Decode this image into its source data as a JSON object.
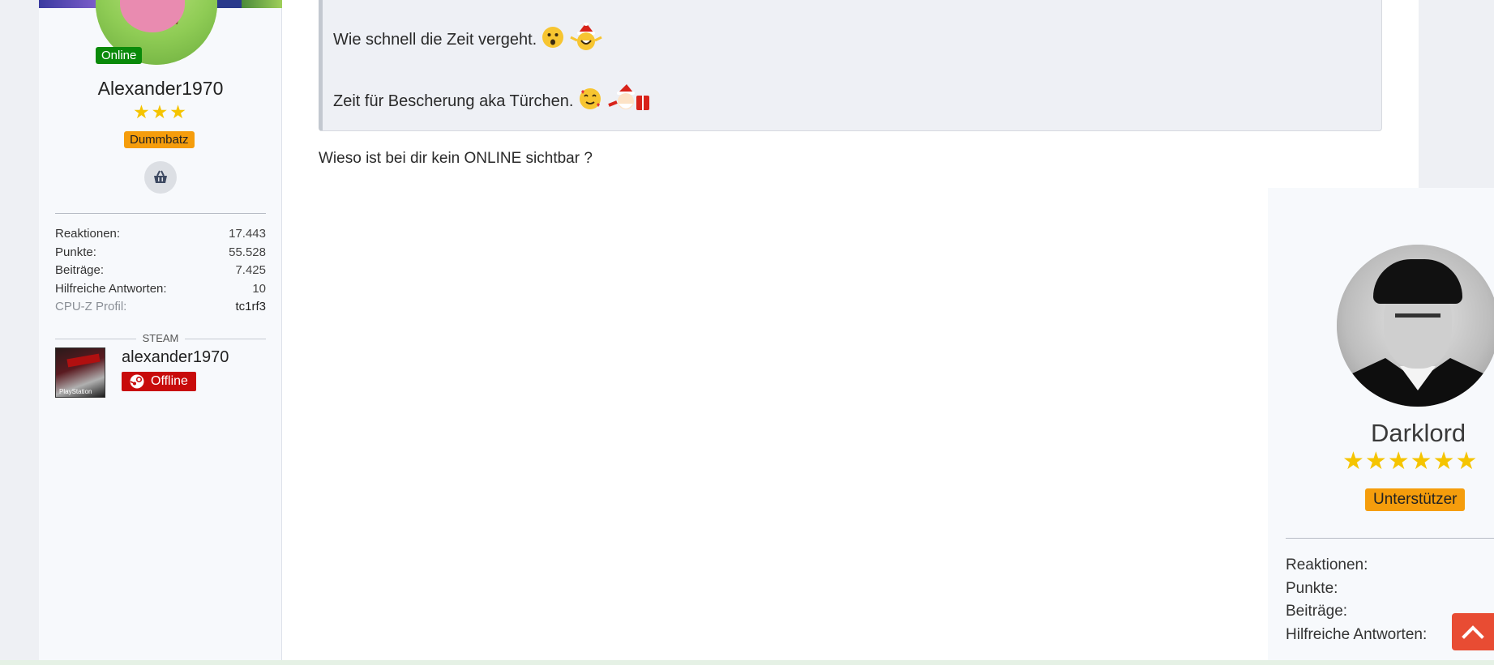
{
  "left_user": {
    "status": "Online",
    "username": "Alexander1970",
    "stars": "★★★",
    "rank": "Dummbatz",
    "stats": [
      {
        "label": "Reaktionen:",
        "value": "17.443"
      },
      {
        "label": "Punkte:",
        "value": "55.528"
      },
      {
        "label": "Beiträge:",
        "value": "7.425"
      },
      {
        "label": "Hilfreiche Antworten:",
        "value": "10"
      },
      {
        "label": "CPU-Z Profil:",
        "value": "tc1rf3"
      }
    ],
    "steam": {
      "header": "STEAM",
      "name": "alexander1970",
      "status": "Offline",
      "avatar_caption": "PlayStation"
    }
  },
  "post": {
    "quote_lines": [
      {
        "text": "Wie schnell die Zeit vergeht.",
        "emojis": [
          "😯",
          "🎅"
        ]
      },
      {
        "text": "Zeit für Bescherung aka Türchen.",
        "emojis": [
          "🥰",
          "🎁"
        ]
      }
    ],
    "reply": "Wieso ist bei dir kein ONLINE sichtbar ?"
  },
  "right_user": {
    "username": "Darklord",
    "stars": "★★★★★★",
    "rank": "Unterstützer",
    "stats": [
      "Reaktionen:",
      "Punkte:",
      "Beiträge:",
      "Hilfreiche Antworten:"
    ]
  },
  "icons": {
    "basket": "basket-icon",
    "steam": "steam-icon",
    "scroll_top": "chevron-up-icon"
  },
  "colors": {
    "online": "#0a8a0a",
    "rank": "#f59d0c",
    "offline": "#c80b0b",
    "stars": "#f5c400",
    "scroll_top": "#e84c33"
  }
}
